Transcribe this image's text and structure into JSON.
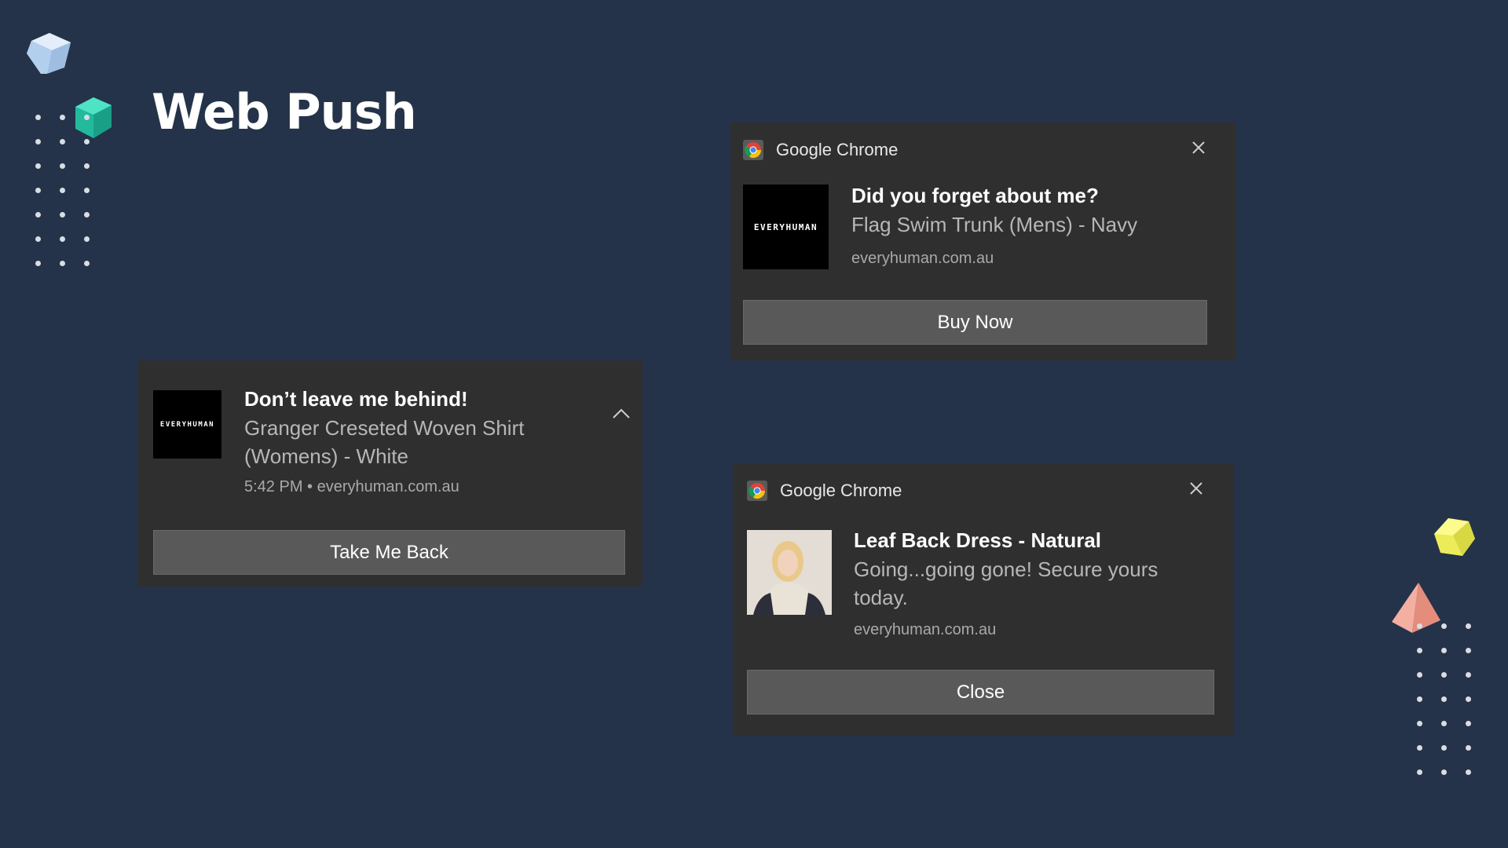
{
  "page": {
    "title": "Web Push"
  },
  "notifications": {
    "left": {
      "brand": "EVERYHUMAN",
      "title": "Don’t leave me behind!",
      "body_line1": "Granger Creseted Woven Shirt",
      "body_line2": "(Womens) - White",
      "meta": "5:42 PM • everyhuman.com.au",
      "action": "Take Me Back"
    },
    "top_right": {
      "app": "Google Chrome",
      "brand": "EVERYHUMAN",
      "title": "Did you forget about me?",
      "body": "Flag Swim Trunk (Mens) - Navy",
      "meta": "everyhuman.com.au",
      "action": "Buy Now"
    },
    "bottom_right": {
      "app": "Google Chrome",
      "title": "Leaf Back Dress - Natural",
      "body_line1": "Going...going gone! Secure yours",
      "body_line2": "today.",
      "meta": "everyhuman.com.au",
      "action": "Close"
    }
  },
  "icons": [
    "cube-icon",
    "chrome-icon",
    "close-icon",
    "chevron-up-icon",
    "pyramid-icon"
  ],
  "colors": {
    "background": "#243349",
    "card": "#2f2f2f",
    "button": "#595959",
    "cube_blue": "#b9d3ef",
    "cube_teal": "#2fcdb0",
    "cube_yellow": "#f4f36b",
    "pyramid_pink": "#f0a596"
  }
}
